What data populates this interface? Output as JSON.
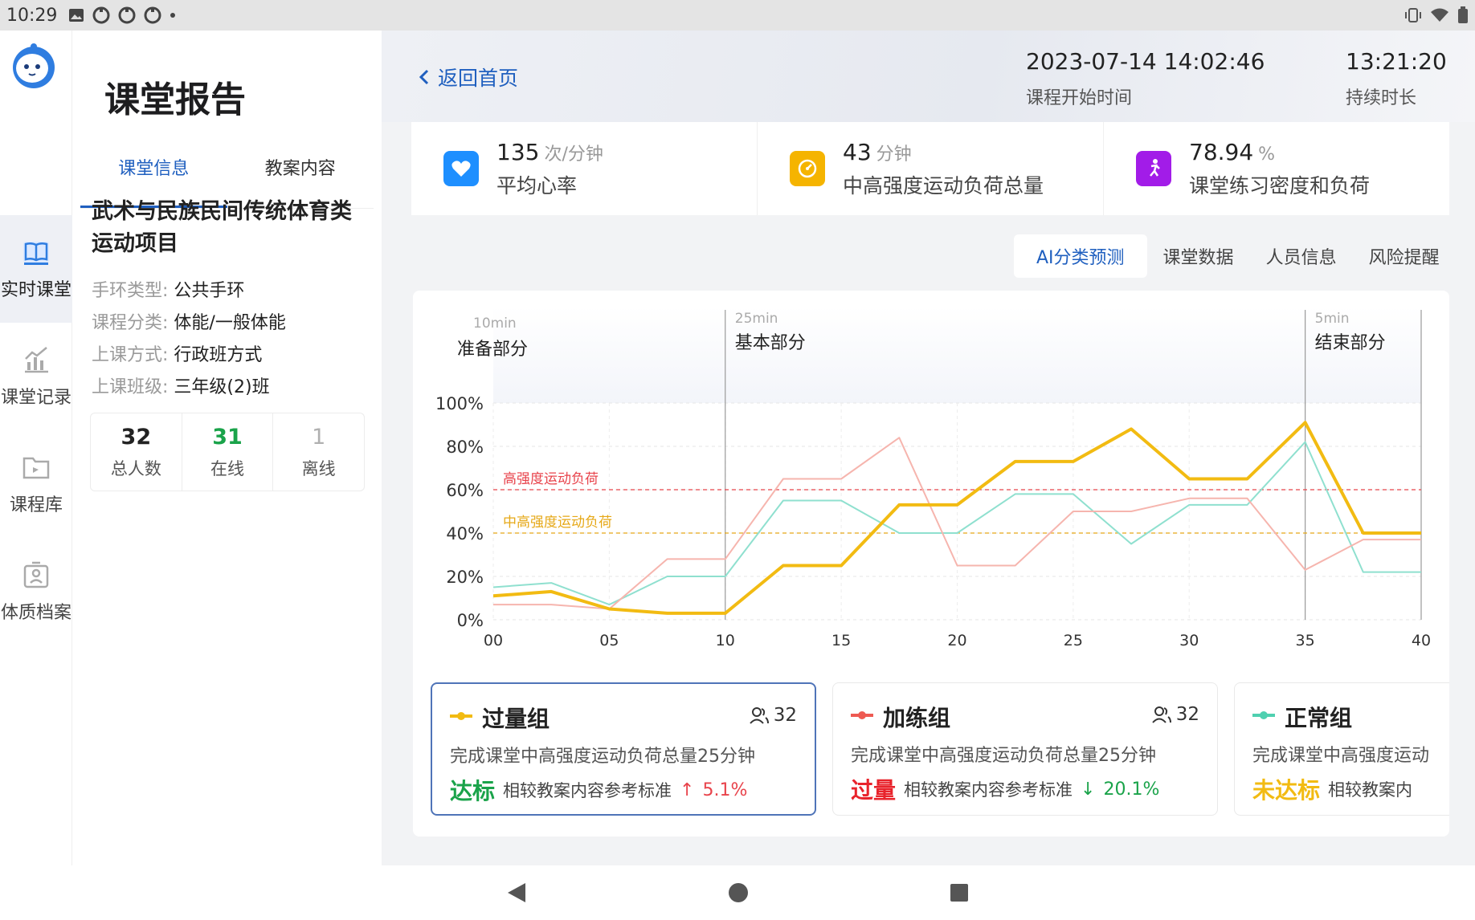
{
  "status_bar": {
    "time": "10:29"
  },
  "rail": {
    "items": [
      {
        "label": "实时课堂",
        "icon": "book-icon"
      },
      {
        "label": "课堂记录",
        "icon": "bar-chart-icon"
      },
      {
        "label": "课程库",
        "icon": "folder-icon"
      },
      {
        "label": "体质档案",
        "icon": "profile-icon"
      }
    ]
  },
  "left_panel": {
    "title": "课堂报告",
    "tabs": [
      "课堂信息",
      "教案内容"
    ],
    "course_title": "武术与民族民间传统体育类运动项目",
    "info": [
      {
        "key": "手环类型:",
        "value": "公共手环"
      },
      {
        "key": "课程分类:",
        "value": "体能/一般体能"
      },
      {
        "key": "上课方式:",
        "value": "行政班方式"
      },
      {
        "key": "上课班级:",
        "value": "三年级(2)班"
      }
    ],
    "counts": [
      {
        "value": "32",
        "label": "总人数",
        "color": "#222222"
      },
      {
        "value": "31",
        "label": "在线",
        "color": "#1aa34a"
      },
      {
        "value": "1",
        "label": "离线",
        "color": "#b0b0b0"
      }
    ]
  },
  "header": {
    "back_label": "返回首页",
    "start_time": "2023-07-14 14:02:46",
    "start_label": "课程开始时间",
    "duration": "13:21:20",
    "duration_label": "持续时长"
  },
  "stats": [
    {
      "value": "135",
      "unit": "次/分钟",
      "label": "平均心率",
      "icon": "heart-icon",
      "color": "#1e8fff"
    },
    {
      "value": "43",
      "unit": "分钟",
      "label": "中高强度运动负荷总量",
      "icon": "gauge-icon",
      "color": "#f5b400"
    },
    {
      "value": "78.94",
      "unit": "%",
      "label": "课堂练习密度和负荷",
      "icon": "runner-icon",
      "color": "#a21ce8"
    }
  ],
  "sub_tabs": [
    "AI分类预测",
    "课堂数据",
    "人员信息",
    "风险提醒"
  ],
  "chart_data": {
    "type": "line",
    "xlim": [
      0,
      40
    ],
    "ylim": [
      0,
      100
    ],
    "x_ticks": [
      "00",
      "05",
      "10",
      "15",
      "20",
      "25",
      "30",
      "35",
      "40"
    ],
    "y_ticks": [
      "0%",
      "20%",
      "40%",
      "60%",
      "80%",
      "100%"
    ],
    "phases": [
      {
        "duration": "10min",
        "name": "准备部分",
        "x": 0
      },
      {
        "duration": "25min",
        "name": "基本部分",
        "x": 10
      },
      {
        "duration": "5min",
        "name": "结束部分",
        "x": 35
      }
    ],
    "thresholds": [
      {
        "label": "高强度运动负荷",
        "y": 60,
        "color": "#e8434b"
      },
      {
        "label": "中高强度运动负荷",
        "y": 40,
        "color": "#e6a817"
      }
    ],
    "series": [
      {
        "key": "normal",
        "color": "#8fe0cf",
        "width": 2,
        "x": [
          0,
          2.5,
          5,
          7.5,
          10,
          12.5,
          15,
          17.5,
          20,
          22.5,
          25,
          27.5,
          30,
          32.5,
          35,
          37.5,
          40
        ],
        "values": [
          15,
          17,
          7,
          20,
          20,
          55,
          55,
          40,
          40,
          58,
          58,
          35,
          53,
          53,
          82,
          22,
          22
        ]
      },
      {
        "key": "extra",
        "color": "#f6b5ae",
        "width": 2,
        "x": [
          0,
          2.5,
          5,
          7.5,
          10,
          12.5,
          15,
          17.5,
          20,
          22.5,
          25,
          27.5,
          30,
          32.5,
          35,
          37.5,
          40
        ],
        "values": [
          7,
          7,
          5,
          28,
          28,
          65,
          65,
          84,
          25,
          25,
          50,
          50,
          56,
          56,
          23,
          37,
          37
        ]
      },
      {
        "key": "over",
        "color": "#f2bb12",
        "width": 4,
        "x": [
          0,
          2.5,
          5,
          7.5,
          10,
          12.5,
          15,
          17.5,
          20,
          22.5,
          25,
          27.5,
          30,
          32.5,
          35,
          37.5,
          40
        ],
        "values": [
          11,
          13,
          5,
          3,
          3,
          25,
          25,
          53,
          53,
          73,
          73,
          88,
          65,
          65,
          91,
          40,
          40
        ]
      }
    ]
  },
  "groups": [
    {
      "name": "过量组",
      "count": "32",
      "color": "#f2bb12",
      "desc": "完成课堂中高强度运动负荷总量25分钟",
      "status": "达标",
      "status_color": "#1aa34a",
      "ref": "相较教案内容参考标准",
      "arrow": "↑",
      "arrow_color": "#e8434b",
      "pct": "5.1%",
      "pct_color": "#e8434b",
      "active": true
    },
    {
      "name": "加练组",
      "count": "32",
      "color": "#ee5a52",
      "desc": "完成课堂中高强度运动负荷总量25分钟",
      "status": "过量",
      "status_color": "#e8232b",
      "ref": "相较教案内容参考标准",
      "arrow": "↓",
      "arrow_color": "#1aa34a",
      "pct": "20.1%",
      "pct_color": "#1aa34a",
      "active": false
    },
    {
      "name": "正常组",
      "count": "",
      "color": "#4fd0b0",
      "desc": "完成课堂中高强度运动",
      "status": "未达标",
      "status_color": "#f2bb12",
      "ref": "相较教案内",
      "arrow": "",
      "arrow_color": "#1aa34a",
      "pct": "",
      "pct_color": "#1aa34a",
      "active": false
    }
  ]
}
